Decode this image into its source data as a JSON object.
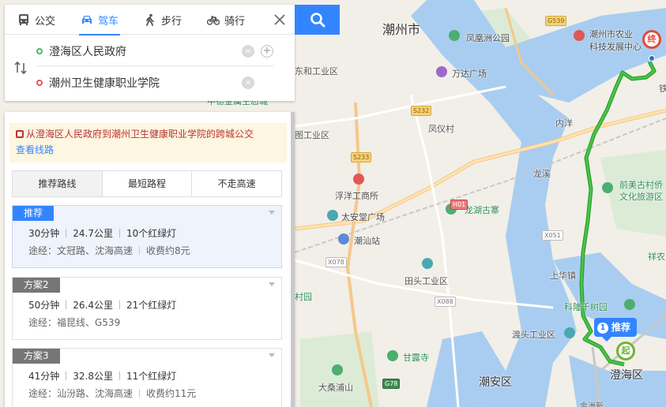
{
  "mode_tabs": [
    {
      "label": "公交",
      "icon": "bus-icon"
    },
    {
      "label": "驾车",
      "icon": "car-icon",
      "active": true
    },
    {
      "label": "步行",
      "icon": "walk-icon"
    },
    {
      "label": "骑行",
      "icon": "bike-icon"
    }
  ],
  "route": {
    "start": "澄海区人民政府",
    "end": "潮州卫生健康职业学院"
  },
  "bus_tip": {
    "text": "从澄海区人民政府到潮州卫生健康职业学院的跨城公交",
    "link": "查看线路"
  },
  "preference_tabs": [
    "推荐路线",
    "最短路程",
    "不走高速"
  ],
  "plans": [
    {
      "badge": "推荐",
      "time": "30分钟",
      "distance": "24.7公里",
      "lights": "10个红绿灯",
      "via": "途经：文冠路、沈海高速",
      "toll": "收费约8元",
      "selected": true
    },
    {
      "badge": "方案2",
      "time": "50分钟",
      "distance": "26.4公里",
      "lights": "21个红绿灯",
      "via": "途经：福昆线、G539",
      "toll": ""
    },
    {
      "badge": "方案3",
      "time": "41分钟",
      "distance": "32.8公里",
      "lights": "11个红绿灯",
      "via": "途经：汕汾路、沈海高速",
      "toll": "收费约11元"
    }
  ],
  "map": {
    "route_tip": {
      "num": "1",
      "label": "推荐"
    },
    "start_marker": "起",
    "end_marker": "终",
    "labels": {
      "chaozhou": "潮州市",
      "fenghuangzhou": "凤凰洲公园",
      "dongheye": "东和工业区",
      "wanda": "万达广场",
      "nongye": "潮州市农业",
      "nongye2": "科技发展中心",
      "fengwu": "凤仪村",
      "tugong": "图工业区",
      "neiyang": "内洋",
      "zhongde": "中德金属生态城",
      "fuyang": "浮洋工商所",
      "taian": "太安堂广场",
      "longhu": "龙湖古寨",
      "chaoshan": "潮汕站",
      "longxi": "龙溪",
      "qianmei": "前美古村侨",
      "qianmei2": "文化旅游区",
      "tiantou": "田头工业区",
      "shanghua": "上华镇",
      "kelong": "科隆千树园",
      "dutou": "渡头工业区",
      "ganlu": "甘露寺",
      "dasang": "大桑浦山",
      "chaoan": "潮安区",
      "chenghai": "澄海区",
      "xiangwei": "祥农",
      "cun": "村园",
      "jinzhou": "金洲新",
      "tie": "铁"
    },
    "shields": {
      "g539": "G539",
      "s232": "S232",
      "s233": "S233",
      "x078": "X078",
      "x051": "X051",
      "x088": "X088",
      "g78": "G78",
      "h01": "H01"
    }
  }
}
